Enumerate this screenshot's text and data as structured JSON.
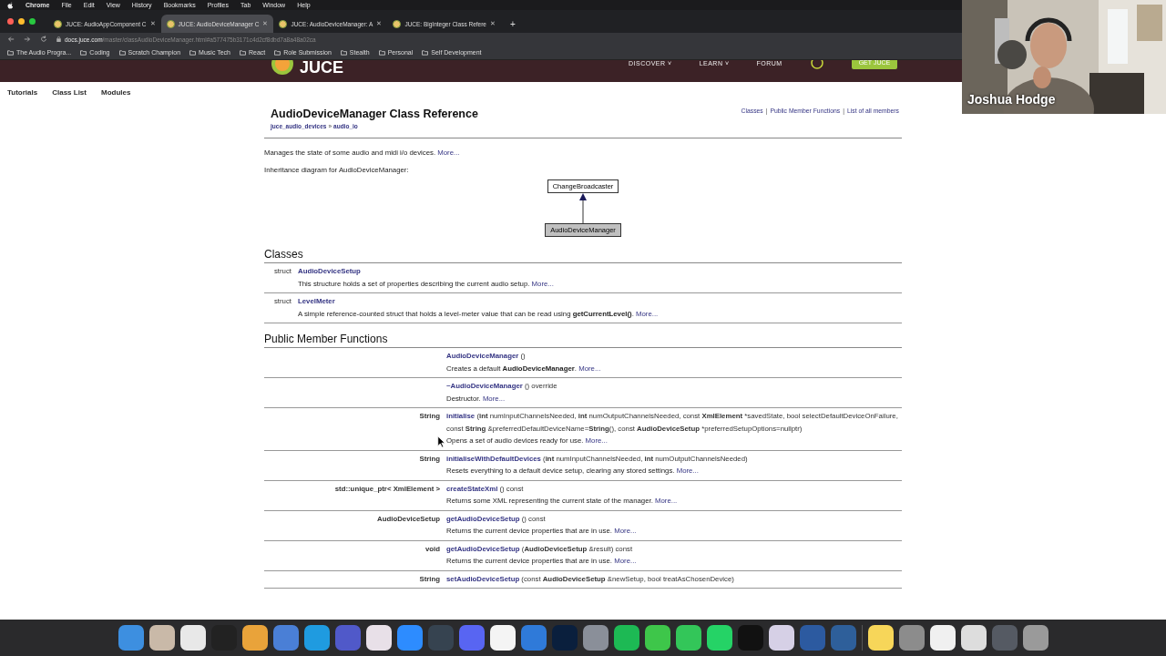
{
  "menu_bar": {
    "app": "Chrome",
    "items": [
      "File",
      "Edit",
      "View",
      "History",
      "Bookmarks",
      "Profiles",
      "Tab",
      "Window",
      "Help"
    ]
  },
  "tabs": [
    {
      "title": "JUCE: AudioAppComponent C",
      "selected": false
    },
    {
      "title": "JUCE: AudioDeviceManager C",
      "selected": true
    },
    {
      "title": "JUCE: AudioDeviceManager: A",
      "selected": false
    },
    {
      "title": "JUCE: BigInteger Class Refere",
      "selected": false
    }
  ],
  "tab_glyphs": {
    "close": "✕",
    "new": "+"
  },
  "address": {
    "host": "docs.juce.com",
    "path": "/master/classAudioDeviceManager.html#a577475b3171c4d2cf8dbd7a8a48a02ca"
  },
  "bookmarks": [
    "The Audio Progra...",
    "Coding",
    "Scratch Champion",
    "Music Tech",
    "React",
    "Role Submission",
    "Stealth",
    "Personal",
    "Self Development"
  ],
  "site_header": {
    "logo": "JUCE",
    "nav": [
      "DISCOVER ˅",
      "LEARN ˅",
      "FORUM"
    ],
    "cta": "GET JUCE"
  },
  "sub_nav": [
    "Tutorials",
    "Class List",
    "Modules"
  ],
  "page": {
    "title": "AudioDeviceManager Class Reference",
    "breadcrumb": [
      "juce_audio_devices",
      "audio_io"
    ],
    "breadcrumb_separator": "»",
    "section_separator": "|",
    "section_links": [
      "Classes",
      "Public Member Functions",
      "List of all members"
    ],
    "brief": "Manages the state of some audio and midi i/o devices.",
    "brief_more": "More...",
    "diagram_caption": "Inheritance diagram for AudioDeviceManager:",
    "diagram": {
      "base": "ChangeBroadcaster",
      "derived": "AudioDeviceManager"
    },
    "classes_heading": "Classes",
    "classes": [
      {
        "kind": "struct",
        "name": "AudioDeviceSetup",
        "description": "This structure holds a set of properties describing the current audio setup.",
        "more": "More..."
      },
      {
        "kind": "struct",
        "name": "LevelMeter",
        "description": "A simple reference-counted struct that holds a level-meter value that can be read using **getCurrentLevel()**.",
        "more": "More..."
      }
    ],
    "functions_heading": "Public Member Functions",
    "functions": [
      {
        "name": "AudioDeviceManager",
        "signature": "()",
        "description": "Creates a default **AudioDeviceManager**.",
        "more": "More..."
      },
      {
        "name": "~AudioDeviceManager",
        "signature": "() override",
        "description": "Destructor.",
        "more": "More..."
      },
      {
        "type": "String",
        "name": "initialise",
        "signature": "(**int** numInputChannelsNeeded, **int** numOutputChannelsNeeded, const **XmlElement** *savedState, bool selectDefaultDeviceOnFailure, const **String** &preferredDefaultDeviceName=**String**(), const **AudioDeviceSetup** *preferredSetupOptions=nullptr)",
        "description": "Opens a set of audio devices ready for use.",
        "more": "More..."
      },
      {
        "type": "String",
        "name": "initialiseWithDefaultDevices",
        "signature": "(**int** numInputChannelsNeeded, **int** numOutputChannelsNeeded)",
        "description": "Resets everything to a default device setup, clearing any stored settings.",
        "more": "More..."
      },
      {
        "type": "std::unique_ptr< **XmlElement** >",
        "name": "createStateXml",
        "signature": "() const",
        "description": "Returns some XML representing the current state of the manager.",
        "more": "More..."
      },
      {
        "type": "**AudioDeviceSetup**",
        "name": "getAudioDeviceSetup",
        "signature": "() const",
        "description": "Returns the current device properties that are in use.",
        "more": "More..."
      },
      {
        "type": "void",
        "name": "getAudioDeviceSetup",
        "signature": "(**AudioDeviceSetup** &result) const",
        "description": "Returns the current device properties that are in use.",
        "more": "More..."
      },
      {
        "type": "String",
        "name": "setAudioDeviceSetup",
        "signature": "(const **AudioDeviceSetup** &newSetup, bool treatAsChosenDevice)"
      }
    ]
  },
  "video": {
    "participant": "Joshua Hodge"
  },
  "dock": [
    {
      "color": "#3d8fe0"
    },
    {
      "color": "#c9b9a8"
    },
    {
      "color": "#e8e8e8"
    },
    {
      "color": "#222222"
    },
    {
      "color": "#e9a33a"
    },
    {
      "color": "#4a7fd6"
    },
    {
      "color": "#1f9be0"
    },
    {
      "color": "#5059c9"
    },
    {
      "color": "#e8e0e8"
    },
    {
      "color": "#2d8cff"
    },
    {
      "color": "#364350"
    },
    {
      "color": "#5865f2"
    },
    {
      "color": "#f4f4f4"
    },
    {
      "color": "#2f7ad9"
    },
    {
      "color": "#0a1f3d"
    },
    {
      "color": "#8a8f99"
    },
    {
      "color": "#1db954"
    },
    {
      "color": "#3ec64a"
    },
    {
      "color": "#33c659"
    },
    {
      "color": "#25d366"
    },
    {
      "color": "#111111"
    },
    {
      "color": "#d6d0e6"
    },
    {
      "color": "#2c5aa0"
    },
    {
      "color": "#2e5f9a"
    },
    {
      "color": "#f7d659"
    },
    {
      "color": "#8c8c8c"
    },
    {
      "color": "#f0f0f0"
    },
    {
      "color": "#dddddd"
    },
    {
      "color": "#555a63"
    },
    {
      "color": "#9a9a9a"
    }
  ]
}
